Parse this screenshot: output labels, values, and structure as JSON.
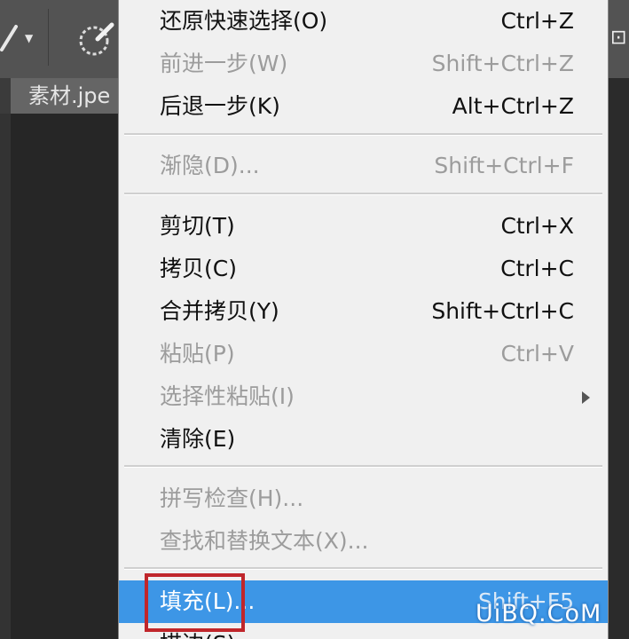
{
  "document_tab": {
    "label": "素材.jpe"
  },
  "menu": {
    "groups": [
      [
        {
          "label": "还原快速选择(O)",
          "shortcut": "Ctrl+Z",
          "enabled": true
        },
        {
          "label": "前进一步(W)",
          "shortcut": "Shift+Ctrl+Z",
          "enabled": false
        },
        {
          "label": "后退一步(K)",
          "shortcut": "Alt+Ctrl+Z",
          "enabled": true
        }
      ],
      [
        {
          "label": "渐隐(D)...",
          "shortcut": "Shift+Ctrl+F",
          "enabled": false
        }
      ],
      [
        {
          "label": "剪切(T)",
          "shortcut": "Ctrl+X",
          "enabled": true
        },
        {
          "label": "拷贝(C)",
          "shortcut": "Ctrl+C",
          "enabled": true
        },
        {
          "label": "合并拷贝(Y)",
          "shortcut": "Shift+Ctrl+C",
          "enabled": true
        },
        {
          "label": "粘贴(P)",
          "shortcut": "Ctrl+V",
          "enabled": false
        },
        {
          "label": "选择性粘贴(I)",
          "shortcut": "",
          "enabled": false,
          "submenu": true
        },
        {
          "label": "清除(E)",
          "shortcut": "",
          "enabled": true
        }
      ],
      [
        {
          "label": "拼写检查(H)...",
          "shortcut": "",
          "enabled": false
        },
        {
          "label": "查找和替换文本(X)...",
          "shortcut": "",
          "enabled": false
        }
      ],
      [
        {
          "label": "填充(L)...",
          "shortcut": "Shift+F5",
          "enabled": true,
          "highlighted": true
        },
        {
          "label": "描边(S)...",
          "shortcut": "",
          "enabled": true
        }
      ]
    ]
  },
  "colors": {
    "highlight": "#3d96e6",
    "annotation_box": "#c0262b"
  },
  "watermark": "UiBQ.CoM"
}
